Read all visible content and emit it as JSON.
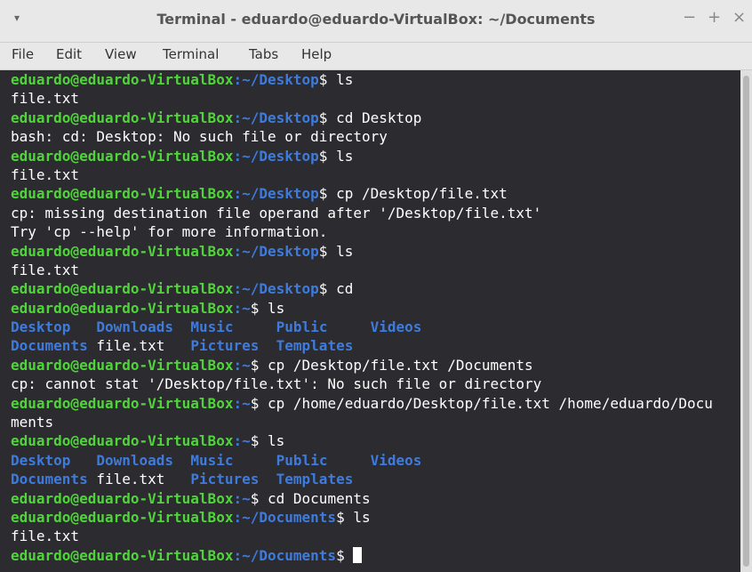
{
  "window": {
    "title": "Terminal - eduardo@eduardo-VirtualBox: ~/Documents",
    "menu_glyph": "▾",
    "minimize": "−",
    "maximize": "+",
    "close": "×"
  },
  "menu": [
    "File",
    "Edit",
    "View",
    "Terminal",
    "Tabs",
    "Help"
  ],
  "colors": {
    "prompt_user": "#51d43b",
    "prompt_path": "#3f7bdb",
    "directory": "#3f7bdb",
    "background": "#2b2b30",
    "text": "#ffffff"
  },
  "terminal": {
    "prompt_user": "eduardo@eduardo-VirtualBox",
    "lines": [
      {
        "type": "prompt",
        "cwd": "~/Desktop",
        "cmd": " ls"
      },
      {
        "type": "out",
        "text": "file.txt"
      },
      {
        "type": "prompt",
        "cwd": "~/Desktop",
        "cmd": " cd Desktop"
      },
      {
        "type": "out",
        "text": "bash: cd: Desktop: No such file or directory"
      },
      {
        "type": "prompt",
        "cwd": "~/Desktop",
        "cmd": " ls"
      },
      {
        "type": "out",
        "text": "file.txt"
      },
      {
        "type": "prompt",
        "cwd": "~/Desktop",
        "cmd": " cp /Desktop/file.txt"
      },
      {
        "type": "out",
        "text": "cp: missing destination file operand after '/Desktop/file.txt'"
      },
      {
        "type": "out",
        "text": "Try 'cp --help' for more information."
      },
      {
        "type": "prompt",
        "cwd": "~/Desktop",
        "cmd": " ls"
      },
      {
        "type": "out",
        "text": "file.txt"
      },
      {
        "type": "prompt",
        "cwd": "~/Desktop",
        "cmd": " cd"
      },
      {
        "type": "prompt",
        "cwd": "~",
        "cmd": " ls"
      },
      {
        "type": "ls",
        "items": [
          {
            "t": "Desktop",
            "d": true,
            "w": 10
          },
          {
            "t": "Downloads",
            "d": true,
            "w": 11
          },
          {
            "t": "Music",
            "d": true,
            "w": 10
          },
          {
            "t": "Public",
            "d": true,
            "w": 11
          },
          {
            "t": "Videos",
            "d": true,
            "w": 0
          }
        ]
      },
      {
        "type": "ls",
        "items": [
          {
            "t": "Documents",
            "d": true,
            "w": 10
          },
          {
            "t": "file.txt",
            "d": false,
            "w": 11
          },
          {
            "t": "Pictures",
            "d": true,
            "w": 10
          },
          {
            "t": "Templates",
            "d": true,
            "w": 0
          }
        ]
      },
      {
        "type": "prompt",
        "cwd": "~",
        "cmd": " cp /Desktop/file.txt /Documents"
      },
      {
        "type": "out",
        "text": "cp: cannot stat '/Desktop/file.txt': No such file or directory"
      },
      {
        "type": "prompt",
        "cwd": "~",
        "cmd": " cp /home/eduardo/Desktop/file.txt /home/eduardo/Docu"
      },
      {
        "type": "out",
        "text": "ments"
      },
      {
        "type": "prompt",
        "cwd": "~",
        "cmd": " ls"
      },
      {
        "type": "ls",
        "items": [
          {
            "t": "Desktop",
            "d": true,
            "w": 10
          },
          {
            "t": "Downloads",
            "d": true,
            "w": 11
          },
          {
            "t": "Music",
            "d": true,
            "w": 10
          },
          {
            "t": "Public",
            "d": true,
            "w": 11
          },
          {
            "t": "Videos",
            "d": true,
            "w": 0
          }
        ]
      },
      {
        "type": "ls",
        "items": [
          {
            "t": "Documents",
            "d": true,
            "w": 10
          },
          {
            "t": "file.txt",
            "d": false,
            "w": 11
          },
          {
            "t": "Pictures",
            "d": true,
            "w": 10
          },
          {
            "t": "Templates",
            "d": true,
            "w": 0
          }
        ]
      },
      {
        "type": "prompt",
        "cwd": "~",
        "cmd": " cd Documents"
      },
      {
        "type": "prompt",
        "cwd": "~/Documents",
        "cmd": " ls"
      },
      {
        "type": "out",
        "text": "file.txt"
      },
      {
        "type": "prompt",
        "cwd": "~/Documents",
        "cmd": " ",
        "cursor": true
      }
    ]
  }
}
